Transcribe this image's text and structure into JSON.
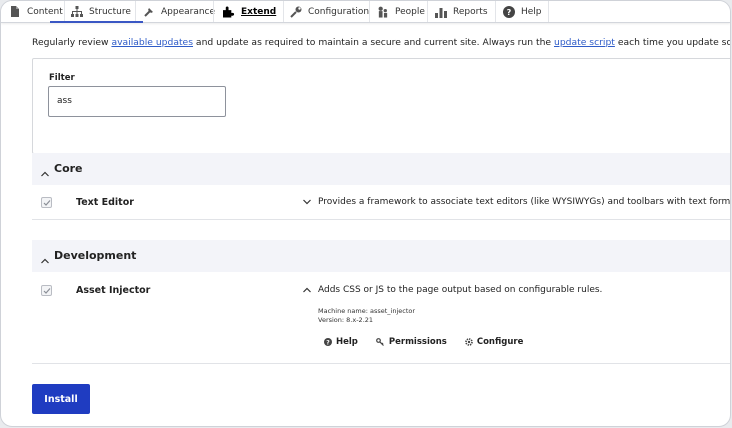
{
  "toolbar": {
    "items": [
      {
        "label": "Content",
        "icon": "content-icon"
      },
      {
        "label": "Structure",
        "icon": "structure-icon"
      },
      {
        "label": "Appearance",
        "icon": "appearance-icon"
      },
      {
        "label": "Extend",
        "icon": "extend-icon",
        "active": true
      },
      {
        "label": "Configuration",
        "icon": "wrench-icon"
      },
      {
        "label": "People",
        "icon": "people-icon"
      },
      {
        "label": "Reports",
        "icon": "reports-icon"
      },
      {
        "label": "Help",
        "icon": "help-icon"
      }
    ]
  },
  "intro": {
    "prefix": "Regularly review ",
    "link1": "available updates",
    "middle": " and update as required to maintain a secure and current site. Always run the ",
    "link2": "update script",
    "suffix": " each time you update software."
  },
  "filter": {
    "label": "Filter",
    "value": "ass"
  },
  "groups": [
    {
      "title": "Core",
      "modules": [
        {
          "name": "Text Editor",
          "description": "Provides a framework to associate text editors (like WYSIWYGs) and toolbars with text formats."
        }
      ]
    },
    {
      "title": "Development",
      "modules": [
        {
          "name": "Asset Injector",
          "description": "Adds CSS or JS to the page output based on configurable rules.",
          "machine_name": "Machine name: asset_injector",
          "version": "Version: 8.x-2.21",
          "links": [
            "Help",
            "Permissions",
            "Configure"
          ]
        }
      ]
    }
  ],
  "install_label": "Install",
  "colors": {
    "accent": "#1f3cc1",
    "link": "#2f5cc8",
    "group_bg": "#f3f4f9"
  }
}
